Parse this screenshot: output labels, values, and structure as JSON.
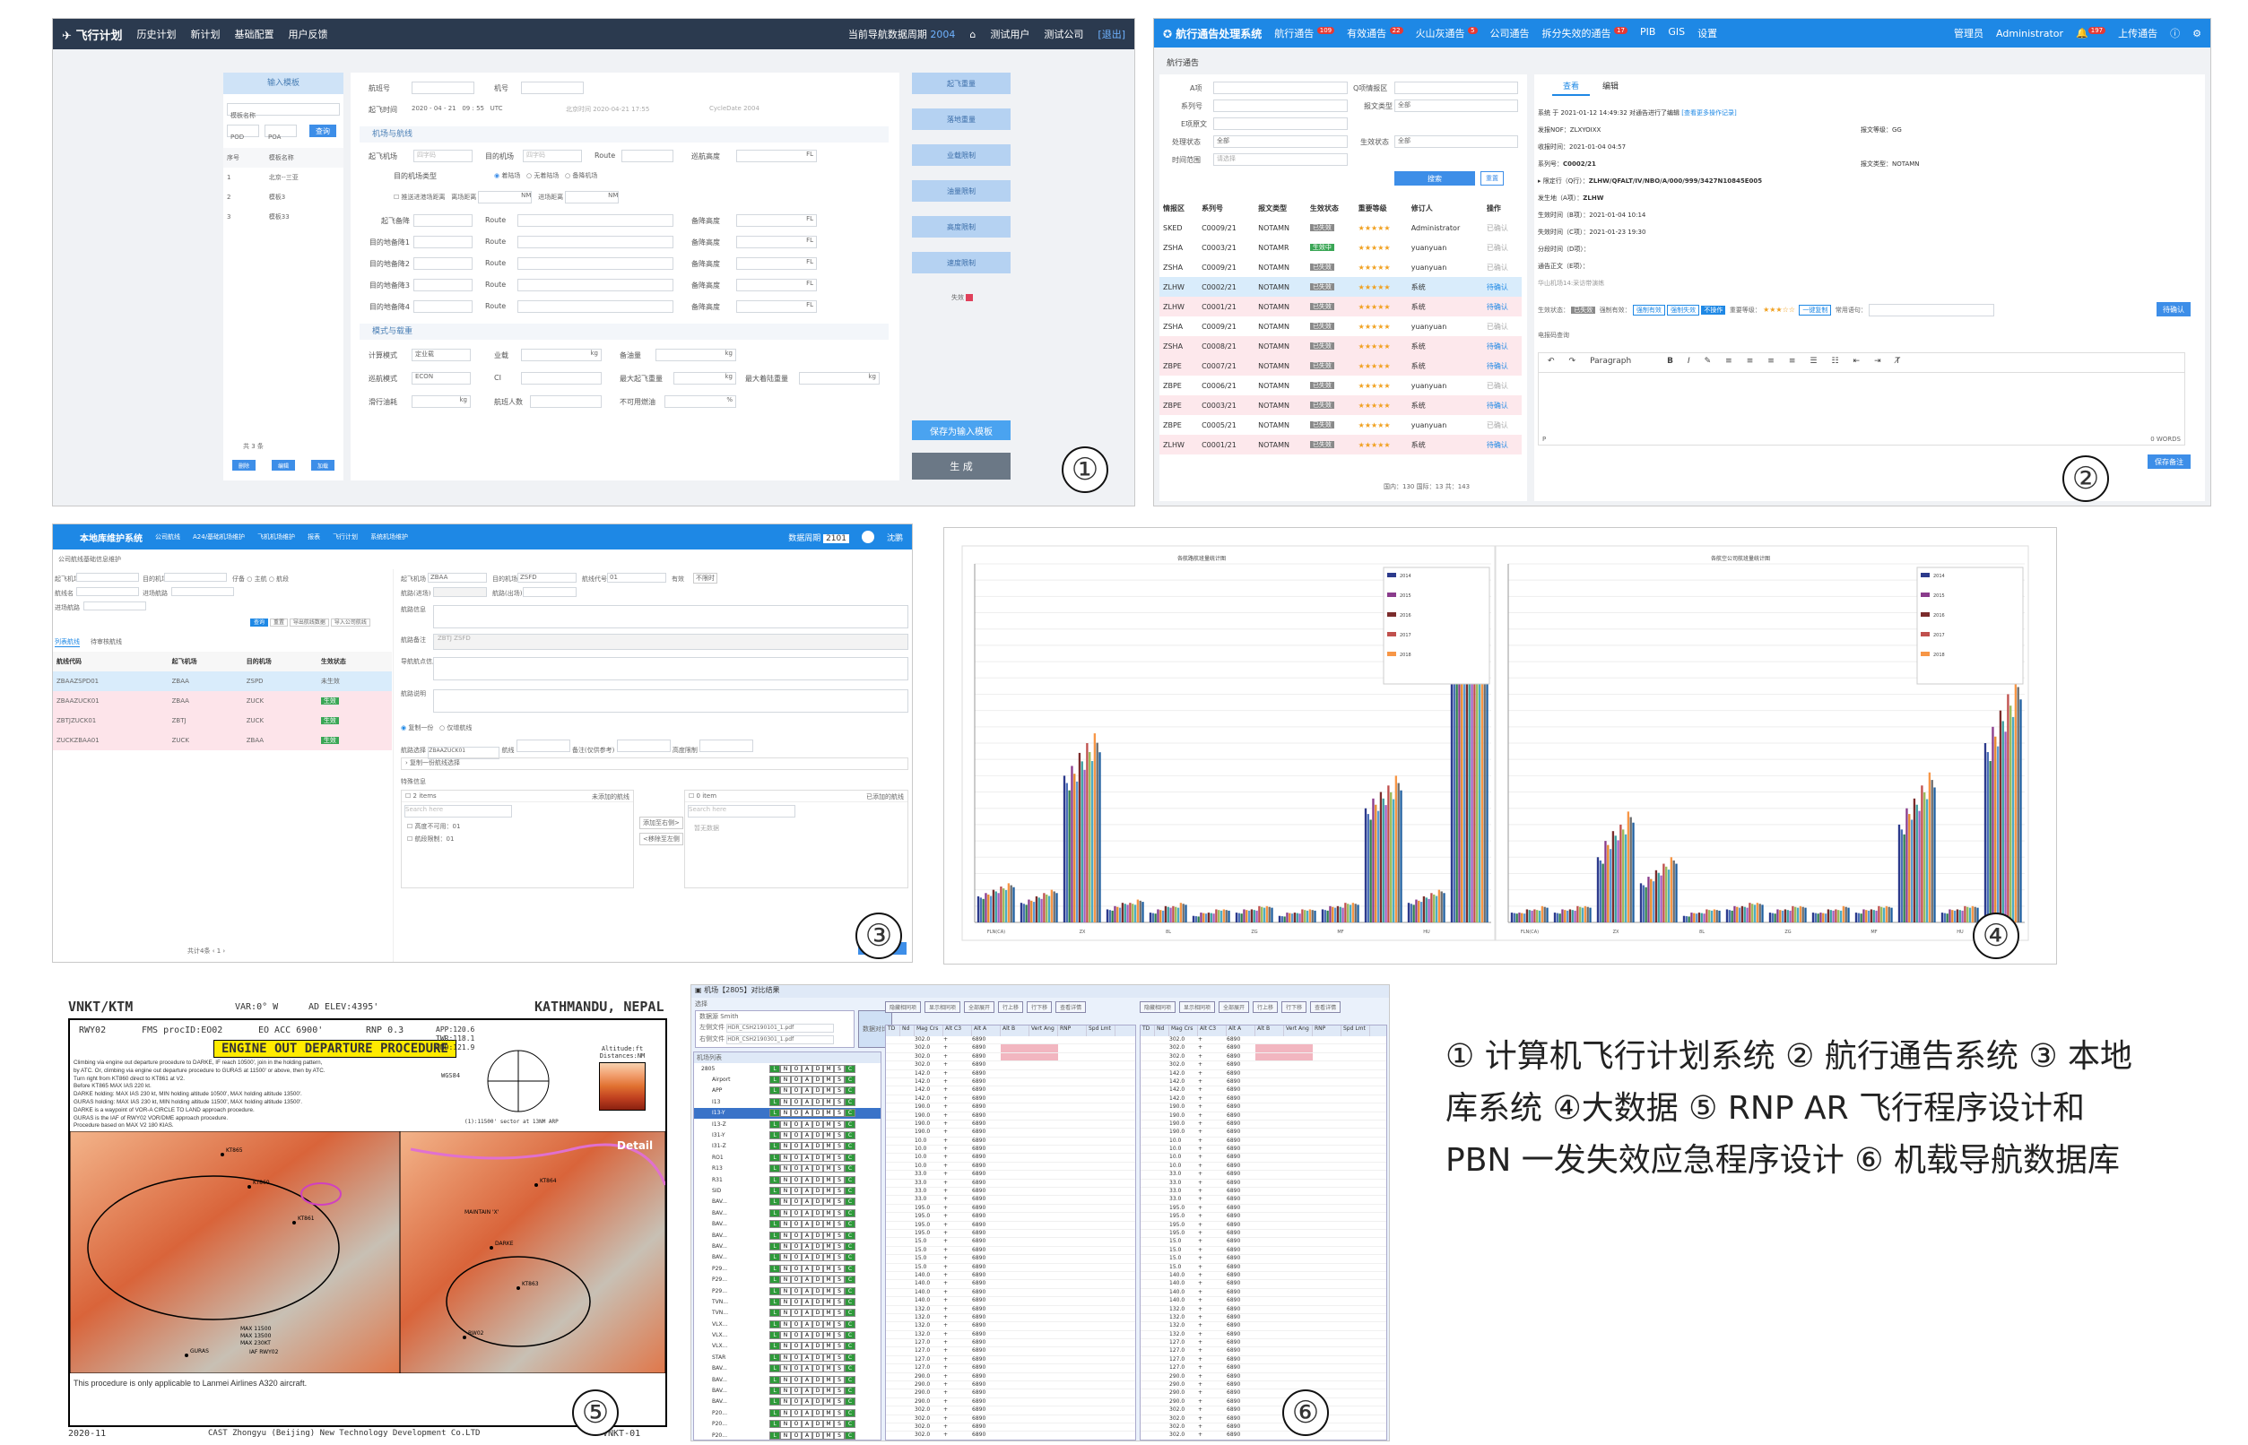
{
  "captions": {
    "text": "① 计算机飞行计划系统 ② 航行通告系统 ③ 本地库系统 ④大数据 ⑤ RNP AR 飞行程序设计和 PBN 一发失效应急程序设计 ⑥ 机载导航数据库"
  },
  "badges": {
    "p1": "①",
    "p2": "②",
    "p3": "③",
    "p4": "④",
    "p5": "⑤",
    "p6": "⑥"
  },
  "panel1": {
    "logo": "飞行计划",
    "nav": [
      "历史计划",
      "新计划",
      "基础配置",
      "用户反馈"
    ],
    "cycle": "当前导航数据周期",
    "cycle_val": "2004",
    "user": "测试用户",
    "company": "测试公司",
    "logout": "[退出]",
    "template_title": "输入模板",
    "template_search": "模板名称",
    "pod": "POD",
    "poa": "POA",
    "query": "查询",
    "tmpl_head": [
      "序号",
      "模板名称"
    ],
    "tmpl_rows": [
      [
        "1",
        "北京--三亚"
      ],
      [
        "2",
        "模板3"
      ],
      [
        "3",
        "模板33"
      ]
    ],
    "tmpl_footer": "共 3 条",
    "tmpl_btns": [
      "删除",
      "编辑",
      "加载"
    ],
    "f_flight": "航班号",
    "f_reg": "机号",
    "f_dep_time": "起飞时间",
    "f_date": [
      "2020",
      "04",
      "21",
      "09",
      "55"
    ],
    "f_utc": "UTC",
    "f_local": "北京时间 2020-04-21 17:55",
    "f_cycle": "CycleDate 2004",
    "sec_route": "机场与航线",
    "r_dep": "起飞机场",
    "r_dep_ph": "四字码",
    "r_arr": "目的机场",
    "r_arr_ph": "四字码",
    "r_route": "Route",
    "r_cruise": "巡航高度",
    "r_fl": "FL",
    "r_types": [
      "目的机场类型",
      "着陆场",
      "无着陆场",
      "备降机场"
    ],
    "r_extra": [
      "推送进港场距离",
      "离场距离",
      "NM",
      "进场距离",
      "NM"
    ],
    "r_alt": [
      "起飞备降",
      "目的地备降1",
      "目的地备降2",
      "目的地备降3",
      "目的地备降4"
    ],
    "r_alt_route": "Route",
    "r_alt_h": "备降高度",
    "sec_mode": "模式与载重",
    "m_calc": "计算模式",
    "m_calc_val": "定业载",
    "m_payload": "业载",
    "m_kg": "kg",
    "m_fuel": "备油量",
    "m_cruise": "巡航模式",
    "m_cruise_val": "ECON",
    "m_ci": "CI",
    "m_zfw": "最大起飞重量",
    "m_lw": "最大着陆重量",
    "m_taxi": "滑行油耗",
    "m_pax": "航班人数",
    "m_unuse": "不可用燃油",
    "m_pct": "%",
    "right_btns": [
      "起飞重量",
      "落地重量",
      "业载限制",
      "油量限制",
      "高度限制",
      "速度限制"
    ],
    "fail": "失效",
    "save_tmpl": "保存为输入模板",
    "generate": "生 成"
  },
  "panel2": {
    "title": "航行通告处理系统",
    "nav": [
      "航行通告",
      "有效通告",
      "火山灰通告",
      "公司通告",
      "拆分失效的通告",
      "PIB",
      "GIS",
      "设置"
    ],
    "nav_badges": [
      "109",
      "22",
      "5",
      "",
      "17",
      "",
      "",
      ""
    ],
    "admin": "管理员",
    "user": "Administrator",
    "notify": "197",
    "upload": "上传通告",
    "breadcrumb": "航行通告",
    "f_a": "A项",
    "f_q": "Q项情报区",
    "f_series": "系列号",
    "f_type": "报文类型",
    "f_type_val": "全部",
    "f_e": "E项原文",
    "f_proc": "处理状态",
    "f_proc_val": "全部",
    "f_eff": "生效状态",
    "f_eff_val": "全部",
    "f_time": "时间范围",
    "f_time_ph": "请选择",
    "search": "搜索",
    "reset": "重置",
    "head": [
      "情报区",
      "系列号",
      "报文类型",
      "生效状态",
      "重要等级",
      "修订人",
      "操作"
    ],
    "rows": [
      [
        "SKED",
        "C0009/21",
        "NOTAMN",
        "已失效",
        "Administrator",
        "已确认"
      ],
      [
        "ZSHA",
        "C0003/21",
        "NOTAMR",
        "生效中",
        "yuanyuan",
        "已确认"
      ],
      [
        "ZSHA",
        "C0009/21",
        "NOTAMN",
        "已失效",
        "yuanyuan",
        "已确认"
      ],
      [
        "ZLHW",
        "C0002/21",
        "NOTAMN",
        "已失效",
        "系统",
        "待确认"
      ],
      [
        "ZLHW",
        "C0001/21",
        "NOTAMN",
        "已失效",
        "系统",
        "待确认"
      ],
      [
        "ZSHA",
        "C0009/21",
        "NOTAMN",
        "已失效",
        "yuanyuan",
        "已确认"
      ],
      [
        "ZSHA",
        "C0008/21",
        "NOTAMN",
        "已失效",
        "系统",
        "待确认"
      ],
      [
        "ZBPE",
        "C0007/21",
        "NOTAMN",
        "已失效",
        "系统",
        "待确认"
      ],
      [
        "ZBPE",
        "C0006/21",
        "NOTAMN",
        "已失效",
        "yuanyuan",
        "已确认"
      ],
      [
        "ZBPE",
        "C0003/21",
        "NOTAMN",
        "已失效",
        "系统",
        "待确认"
      ],
      [
        "ZBPE",
        "C0005/21",
        "NOTAMN",
        "已失效",
        "yuanyuan",
        "已确认"
      ],
      [
        "ZLHW",
        "C0001/21",
        "NOTAMN",
        "已失效",
        "系统",
        "待确认"
      ]
    ],
    "footer": "国内：130  国际：13  共：143",
    "tabs": [
      "查看",
      "编辑"
    ],
    "d_line1": "系统 于 2021-01-12 14:49:32 对通告进行了编辑",
    "d_more": "[查看更多操作记录]",
    "d_nof": "发报NOF：ZLXYOIXX",
    "d_level": "报文等级：GG",
    "d_recv": "收报时间：2021-01-04 04:57",
    "d_series": "系列号：",
    "d_series_val": "C0002/21",
    "d_type": "报文类型：NOTAMN",
    "d_q": "限定行（Q行）：",
    "d_q_val": "ZLHW/QFALT/IV/NBO/A/000/999/3427N10845E005",
    "d_a": "发生地（A项）：",
    "d_a_val": "ZLHW",
    "d_b": "生效时间（B项）：2021-01-04 10:14",
    "d_c": "失效时间（C项）：2021-01-23 19:30",
    "d_d": "分段时间（D项）：",
    "d_e": "通告正文（E项）：",
    "d_e_val": "华山机场14:采访带演练",
    "d_eff": "生效状态：",
    "d_eff_tag": "已失效",
    "d_force": "强制有效：",
    "d_force_btns": [
      "强制有效",
      "强制失效",
      "不操作"
    ],
    "d_imp": "重要等级：",
    "d_copy": "一键复制",
    "d_lang": "常用语句：",
    "d_confirm": "待确认",
    "d_remark": "电报码查询",
    "editor_para": "Paragraph",
    "words": "0 WORDS",
    "editor_p": "P",
    "save_confirm": "保存备注"
  },
  "panel3": {
    "title": "本地库维护系统",
    "nav": [
      "公司航线",
      "A24/基础机场维护",
      "飞机机场维护",
      "报表",
      "飞行计划",
      "系统机场维护"
    ],
    "data_cycle": "数据周期",
    "data_cycle_val": "2101",
    "user": "沈鹏",
    "breadcrumb": "公司航线基础信息维护",
    "f_dep": "起飞机场",
    "f_arr": "目的机场",
    "f_type": "仔备",
    "f_main": "主航",
    "f_sub": "航段",
    "f_route": "航线名",
    "f_final": "进场航路",
    "f_depart": "进场航路",
    "btns": [
      "查询",
      "重置",
      "导出航线数据",
      "导入公司航线"
    ],
    "tabs": [
      "列表航线",
      "待审核航线"
    ],
    "head": [
      "航线代码",
      "起飞机场",
      "目的机场",
      "生效状态"
    ],
    "rows": [
      [
        "ZBAAZSPD01",
        "ZBAA",
        "ZSPD",
        "未生效"
      ],
      [
        "ZBAAZUCK01",
        "ZBAA",
        "ZUCK",
        "生效"
      ],
      [
        "ZBTJZUCK01",
        "ZBTJ",
        "ZUCK",
        "生效"
      ],
      [
        "ZUCKZBAA01",
        "ZUCK",
        "ZBAA",
        "生效"
      ]
    ],
    "pager": "共计4条",
    "r_dep": "起飞机场",
    "r_dep_val": "ZBAA",
    "r_arr": "目的机场",
    "r_arr_val": "ZSFD",
    "r_seq": "航线代号",
    "r_seq_val": "01",
    "r_valid": "有效",
    "r_unit": "不限时",
    "r_route": "航路信息",
    "r_fl1": "航路(进场)",
    "r_fl2": "航路(出场)",
    "r_prog": "ZBTJ ZSFD",
    "r_ref": "航路备注",
    "r_notes": "导航航点信息",
    "r_inst": "航路说明",
    "radios": [
      "复制一份",
      "仅增航线"
    ],
    "cfg": "航路选择",
    "cfg_val": "ZBAAZUCK01",
    "cfg_d": "航线",
    "cfg_b": "备注(仅供参考)",
    "cfg_f": "高度限制",
    "expand": "复制一份航线选择",
    "special": "特殊信息",
    "list_l_title": "2 items",
    "list_l_head": "未添加的航线",
    "list_l_ph": "Search here",
    "list_l": [
      "高度不可用：01",
      "航段限制：01"
    ],
    "list_r_title": "0 item",
    "list_r_head": "已添加的航线",
    "list_r_ph": "Search here",
    "list_r_empty": "暂无数据",
    "move_r": "添加至右侧>",
    "move_l": "<移除至左侧",
    "submit": "提交至审核"
  },
  "panel4": {
    "chart_data": [
      {
        "type": "bar",
        "title": "各航路航班量统计图",
        "categories": [
          "FLN(CA)",
          "7U",
          "ZX",
          "JD(ZH)",
          "8L",
          "U(JD)",
          "ZG",
          "EU",
          "MF",
          "CZ",
          "HU",
          "MU"
        ],
        "series": [
          {
            "name": "2014",
            "values": [
              8,
              6,
              45,
              4,
              3,
              2,
              3,
              2,
              4,
              35,
              6,
              85
            ]
          },
          {
            "name": "2015",
            "values": [
              9,
              7,
              48,
              5,
              4,
              3,
              4,
              3,
              5,
              38,
              7,
              90
            ]
          },
          {
            "name": "2016",
            "values": [
              10,
              8,
              52,
              6,
              5,
              3,
              4,
              3,
              5,
              40,
              8,
              95
            ]
          },
          {
            "name": "2017",
            "values": [
              11,
              9,
              55,
              6,
              5,
              4,
              5,
              4,
              6,
              42,
              9,
              100
            ]
          },
          {
            "name": "2018",
            "values": [
              12,
              10,
              58,
              7,
              6,
              4,
              5,
              4,
              6,
              45,
              10,
              105
            ]
          }
        ],
        "ylim": [
          0,
          110
        ]
      },
      {
        "type": "bar",
        "title": "各航空公司航班量统计图",
        "categories": [
          "FLN(CA)",
          "7U",
          "ZX",
          "JD(ZH)",
          "8L",
          "U(JD)",
          "ZG",
          "EU",
          "MF",
          "CZ",
          "HU",
          "MU"
        ],
        "series": [
          {
            "name": "2014",
            "values": [
              3,
              3,
              20,
              12,
              2,
              4,
              3,
              3,
              3,
              30,
              3,
              55
            ]
          },
          {
            "name": "2015",
            "values": [
              3,
              4,
              25,
              14,
              3,
              5,
              4,
              3,
              4,
              35,
              4,
              60
            ]
          },
          {
            "name": "2016",
            "values": [
              4,
              4,
              28,
              16,
              3,
              5,
              4,
              4,
              4,
              38,
              4,
              65
            ]
          },
          {
            "name": "2017",
            "values": [
              4,
              5,
              30,
              18,
              4,
              6,
              5,
              4,
              5,
              42,
              5,
              70
            ]
          },
          {
            "name": "2018",
            "values": [
              5,
              5,
              34,
              20,
              4,
              6,
              5,
              5,
              5,
              46,
              5,
              76
            ]
          }
        ],
        "ylim": [
          0,
          110
        ]
      }
    ],
    "colors": [
      "#2c3a8c",
      "#4a6db8",
      "#2e7d4f",
      "#8a3c8c",
      "#e88a2e",
      "#5b9bd5",
      "#7b2c2c",
      "#3aa0a0",
      "#a05fc0",
      "#c0504d",
      "#9bbb59",
      "#4bacc6",
      "#f79646",
      "#6b6b6b",
      "#1f5f9f",
      "#d46aa0",
      "#8064a2",
      "#c8a02c",
      "#2a8a6a",
      "#b04030"
    ]
  },
  "panel5": {
    "code_l": "VNKT/KTM",
    "var": "VAR:0° W",
    "elev": "AD ELEV:4395'",
    "city": "KATHMANDU, NEPAL",
    "rwy": "RWY02",
    "fms": "FMS procID:EO02",
    "eo": "EO ACC 6900'",
    "rnp": "RNP 0.3",
    "title": "ENGINE OUT DEPARTURE PROCEDURE",
    "text": [
      "Climbing via engine out departure procedure to DARKE, IF reach 10500', join in the holding pattern,",
      "by ATC. Or, climbing via engine out departure procedure to GURAS at 11500' or above, then by ATC.",
      "Turn right from KT860 direct to KT861 at V2.",
      "Before KT865 MAX IAS 220 kt.",
      "DARKE holding: MAX IAS 230 kt, MIN holding altitude 10500', MAX holding altitude 13500'.",
      "GURAS holding: MAX IAS 230 kt, MIN holding altitude 11500', MAX holding altitude 13500'.",
      "DARKE is a waypoint of VOR-A CIRCLE TO LAND approach procedure.",
      "GURAS is the IAF of RWY02 VOR/DME approach procedure.",
      "Procedure based on MAX V2 180 KIAS."
    ],
    "freq": [
      "APP:120.6",
      "TWR:118.1",
      "GND:121.9"
    ],
    "wgs": "WGS84",
    "msa_note": "(1):11500' sector at 13NM ARP",
    "alt_legend": "Altitude:ft",
    "dist": "Distances:NM",
    "detail": "Detail",
    "note": "This procedure is only applicable to Lanmei Airlines A320 aircraft.",
    "date": "2020-11",
    "company": "CAST Zhongyu (Beijing) New Technology Development Co.LTD",
    "code_r": "VNKT-01",
    "wps": [
      "KT860",
      "KT861",
      "KT863",
      "KT864",
      "KT865",
      "RW02",
      "DARKE",
      "GURAS"
    ],
    "limits": [
      "MAX 11500",
      "MAX 13500",
      "MAX 230KT"
    ],
    "maintain": "MAINTAIN 'X'",
    "iaf": "IAF RWY02"
  },
  "panel6": {
    "title": "机场【2805】对比结果",
    "menu": "选择",
    "dataset": "数据源",
    "dataset_val": "Smith",
    "left_file": "左侧文件",
    "left_val": "HDR_CSH2190101_1.pdf",
    "right_file": "右侧文件",
    "right_val": "HDR_CSH2190301_1.pdf",
    "cmp_btn": "数据对比",
    "tree_head": "机场列表",
    "tree_root": "2805",
    "tree_items": [
      "Airport",
      "APP",
      "I13",
      "I13-Y",
      "I13-Z",
      "I31-Y",
      "I31-Z",
      "RO1",
      "R13",
      "R31",
      "SID",
      "BAV...",
      "BAV...",
      "BAV...",
      "BAV...",
      "BAV...",
      "BAV...",
      "P29...",
      "P29...",
      "P29...",
      "TVN...",
      "TVN...",
      "VLX...",
      "VLX...",
      "VLX...",
      "STAR",
      "BAV...",
      "BAV...",
      "BAV...",
      "BAV...",
      "P20...",
      "P20...",
      "P20..."
    ],
    "tbtns": [
      "隐藏相同项",
      "显示相同项",
      "全部展开",
      "行上移",
      "行下移",
      "查看详情"
    ],
    "col_head": [
      "TD",
      "Nd",
      "Mag Crs",
      "Alt C3",
      "Alt A",
      "Alt B",
      "Vert Ang",
      "RNP",
      "Spd Lmt"
    ],
    "alt": "6890",
    "vals": [
      "302.0",
      "142.0",
      "190.0",
      "10.0",
      "33.0",
      "195.0",
      "15.0",
      "140.0",
      "132.0",
      "127.0",
      "290.0"
    ]
  }
}
